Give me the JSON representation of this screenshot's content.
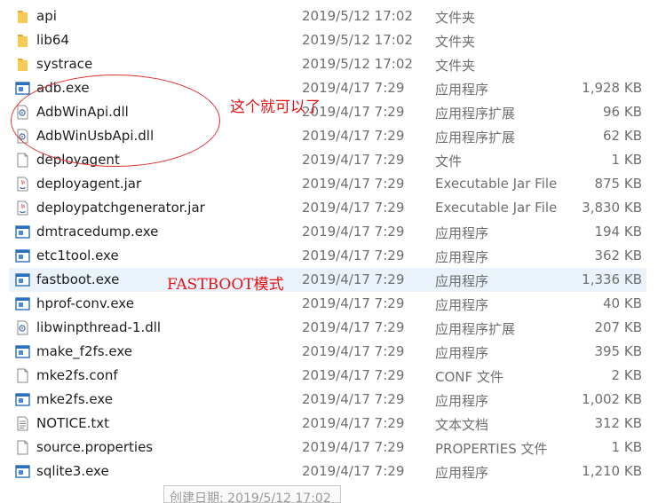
{
  "files": [
    {
      "name": "api",
      "date": "2019/5/12 17:02",
      "type": "文件夹",
      "size": "",
      "icon": "folder-icon"
    },
    {
      "name": "lib64",
      "date": "2019/5/12 17:02",
      "type": "文件夹",
      "size": "",
      "icon": "folder-icon"
    },
    {
      "name": "systrace",
      "date": "2019/5/12 17:02",
      "type": "文件夹",
      "size": "",
      "icon": "folder-icon"
    },
    {
      "name": "adb.exe",
      "date": "2019/4/17 7:29",
      "type": "应用程序",
      "size": "1,928 KB",
      "icon": "exe-icon"
    },
    {
      "name": "AdbWinApi.dll",
      "date": "2019/4/17 7:29",
      "type": "应用程序扩展",
      "size": "96 KB",
      "icon": "dll-icon"
    },
    {
      "name": "AdbWinUsbApi.dll",
      "date": "2019/4/17 7:29",
      "type": "应用程序扩展",
      "size": "62 KB",
      "icon": "dll-icon"
    },
    {
      "name": "deployagent",
      "date": "2019/4/17 7:29",
      "type": "文件",
      "size": "1 KB",
      "icon": "file-icon"
    },
    {
      "name": "deployagent.jar",
      "date": "2019/4/17 7:29",
      "type": "Executable Jar File",
      "size": "875 KB",
      "icon": "jar-icon"
    },
    {
      "name": "deploypatchgenerator.jar",
      "date": "2019/4/17 7:29",
      "type": "Executable Jar File",
      "size": "3,830 KB",
      "icon": "jar-icon"
    },
    {
      "name": "dmtracedump.exe",
      "date": "2019/4/17 7:29",
      "type": "应用程序",
      "size": "194 KB",
      "icon": "exe-icon"
    },
    {
      "name": "etc1tool.exe",
      "date": "2019/4/17 7:29",
      "type": "应用程序",
      "size": "362 KB",
      "icon": "exe-icon"
    },
    {
      "name": "fastboot.exe",
      "date": "2019/4/17 7:29",
      "type": "应用程序",
      "size": "1,336 KB",
      "icon": "exe-icon",
      "selected": true
    },
    {
      "name": "hprof-conv.exe",
      "date": "2019/4/17 7:29",
      "type": "应用程序",
      "size": "40 KB",
      "icon": "exe-icon"
    },
    {
      "name": "libwinpthread-1.dll",
      "date": "2019/4/17 7:29",
      "type": "应用程序扩展",
      "size": "207 KB",
      "icon": "dll-icon"
    },
    {
      "name": "make_f2fs.exe",
      "date": "2019/4/17 7:29",
      "type": "应用程序",
      "size": "395 KB",
      "icon": "exe-icon"
    },
    {
      "name": "mke2fs.conf",
      "date": "2019/4/17 7:29",
      "type": "CONF 文件",
      "size": "2 KB",
      "icon": "file-icon"
    },
    {
      "name": "mke2fs.exe",
      "date": "2019/4/17 7:29",
      "type": "应用程序",
      "size": "1,002 KB",
      "icon": "exe-icon"
    },
    {
      "name": "NOTICE.txt",
      "date": "2019/4/17 7:29",
      "type": "文本文档",
      "size": "312 KB",
      "icon": "txt-icon"
    },
    {
      "name": "source.properties",
      "date": "2019/4/17 7:29",
      "type": "PROPERTIES 文件",
      "size": "1 KB",
      "icon": "file-icon"
    },
    {
      "name": "sqlite3.exe",
      "date": "2019/4/17 7:29",
      "type": "应用程序",
      "size": "1,210 KB",
      "icon": "exe-icon"
    }
  ],
  "annotations": {
    "note_dll": "这个就可以了",
    "note_fastboot": "FASTBOOT模式"
  },
  "tooltip": {
    "text": "创建日期: 2019/5/12 17:02"
  },
  "colors": {
    "folder": "#f0c14b",
    "exe_frame": "#2a6fc0",
    "annotation": "#e81010",
    "selected_row": "#eaf3fb"
  }
}
